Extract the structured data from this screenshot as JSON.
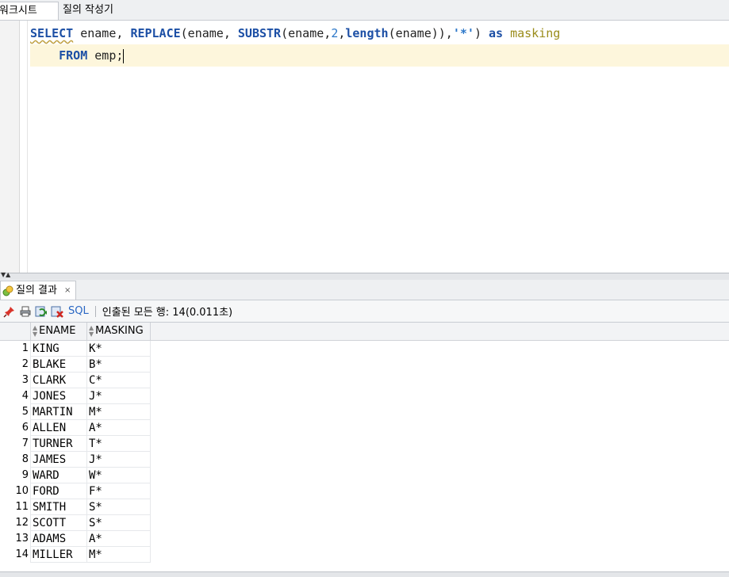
{
  "tabs": {
    "worksheet": "워크시트",
    "query_builder": "질의 작성기"
  },
  "editor": {
    "line1": {
      "select": "SELECT",
      "ename1": " ename, ",
      "replace": "REPLACE",
      "open1": "(ename, ",
      "substr": "SUBSTR",
      "open2": "(ename,",
      "two": "2",
      "comma": ",",
      "length": "length",
      "tail": "(ename)),",
      "star": "'*'",
      "close": ") ",
      "as": "as",
      "alias": " masking"
    },
    "line2": {
      "indent": "    ",
      "from": "FROM",
      "table": " emp;"
    }
  },
  "result_tab": {
    "label": "질의 결과",
    "close": "×"
  },
  "toolbar": {
    "sql_label": "SQL",
    "status": "인출된 모든 행: 14(0.011초)"
  },
  "grid": {
    "columns": [
      "ENAME",
      "MASKING"
    ],
    "rows": [
      {
        "n": "1",
        "ename": "KING",
        "masking": "K*"
      },
      {
        "n": "2",
        "ename": "BLAKE",
        "masking": "B*"
      },
      {
        "n": "3",
        "ename": "CLARK",
        "masking": "C*"
      },
      {
        "n": "4",
        "ename": "JONES",
        "masking": "J*"
      },
      {
        "n": "5",
        "ename": "MARTIN",
        "masking": "M*"
      },
      {
        "n": "6",
        "ename": "ALLEN",
        "masking": "A*"
      },
      {
        "n": "7",
        "ename": "TURNER",
        "masking": "T*"
      },
      {
        "n": "8",
        "ename": "JAMES",
        "masking": "J*"
      },
      {
        "n": "9",
        "ename": "WARD",
        "masking": "W*"
      },
      {
        "n": "10",
        "ename": "FORD",
        "masking": "F*"
      },
      {
        "n": "11",
        "ename": "SMITH",
        "masking": "S*"
      },
      {
        "n": "12",
        "ename": "SCOTT",
        "masking": "S*"
      },
      {
        "n": "13",
        "ename": "ADAMS",
        "masking": "A*"
      },
      {
        "n": "14",
        "ename": "MILLER",
        "masking": "M*"
      }
    ]
  }
}
